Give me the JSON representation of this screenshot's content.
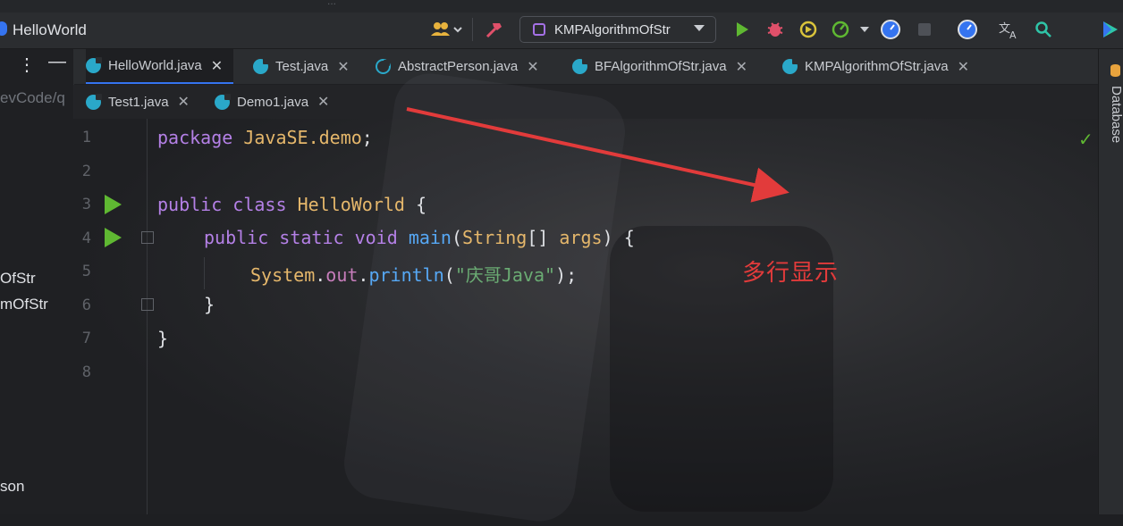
{
  "topbar": {
    "project_name": "HelloWorld",
    "seam_text": "...",
    "run_config": "KMPAlgorithmOfStr",
    "icons": [
      "people-icon",
      "hammer-icon",
      "run-icon",
      "debug-icon",
      "coverage-icon",
      "profiler-icon",
      "chevron-down-icon",
      "speed-icon",
      "stop-icon",
      "speed-icon-2",
      "translate-icon",
      "search-icon",
      "play-store-icon"
    ]
  },
  "left_pane": {
    "path_fragment": "evCode/q",
    "items": [
      "OfStr",
      "mOfStr",
      "son"
    ]
  },
  "tabs_row1": [
    {
      "label": "HelloWorld.java",
      "active": true,
      "icon": "java-class-icon"
    },
    {
      "label": "Test.java",
      "active": false,
      "icon": "java-class-icon"
    },
    {
      "label": "AbstractPerson.java",
      "active": false,
      "icon": "abstract-class-icon"
    },
    {
      "label": "BFAlgorithmOfStr.java",
      "active": false,
      "icon": "java-class-icon"
    },
    {
      "label": "KMPAlgorithmOfStr.java",
      "active": false,
      "icon": "java-class-icon"
    }
  ],
  "tabs_row2": [
    {
      "label": "Test1.java",
      "active": false,
      "icon": "java-class-icon"
    },
    {
      "label": "Demo1.java",
      "active": false,
      "icon": "java-class-icon"
    }
  ],
  "close_glyph": "✕",
  "pane_buttons": {
    "more": "⋮",
    "collapse": "—"
  },
  "right_sidebar": {
    "label": "Database"
  },
  "editor": {
    "line_numbers": [
      "1",
      "2",
      "3",
      "4",
      "5",
      "6",
      "7",
      "8"
    ],
    "lines": {
      "l1": {
        "kw": "package",
        "pkg": "JavaSE.demo",
        "semi": ";"
      },
      "l3": {
        "kw1": "public",
        "kw2": "class",
        "cls": "HelloWorld",
        "brace": "{"
      },
      "l4": {
        "kw1": "public",
        "kw2": "static",
        "kw3": "void",
        "fn": "main",
        "open": "(",
        "type": "String",
        "arr": "[]",
        "param": "args",
        "close": ")",
        "brace": "{"
      },
      "l5": {
        "obj": "System",
        "dot1": ".",
        "field": "out",
        "dot2": ".",
        "method": "println",
        "open": "(",
        "str": "\"庆哥Java\"",
        "close": ");"
      },
      "l6": {
        "brace": "}"
      },
      "l7": {
        "brace": "}"
      }
    },
    "inspection_status": "✓"
  },
  "annotation": {
    "text": "多行显示",
    "color": "#e23b3b"
  },
  "colors": {
    "accent": "#3574f0",
    "run_green": "#5fb832",
    "annotation_red": "#e23b3b"
  }
}
